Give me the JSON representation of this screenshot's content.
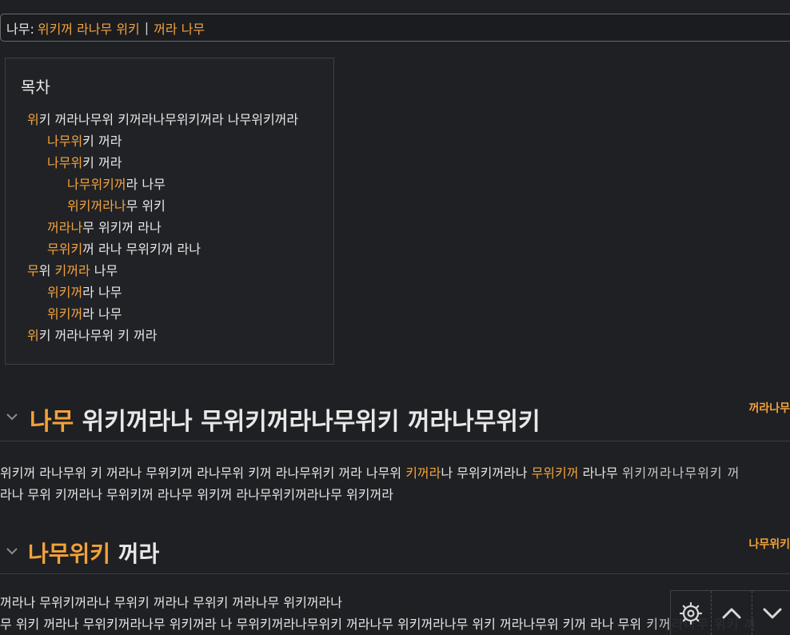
{
  "category_bar": {
    "label": "나무:",
    "links": [
      "위키꺼 라나무 위키",
      "꺼라 나무"
    ],
    "separator": "|"
  },
  "toc": {
    "title": "목차",
    "items": [
      {
        "level": 1,
        "num": "위",
        "text": "키 꺼라나무위 키꺼라나무위키꺼라 나무위키꺼라"
      },
      {
        "level": 2,
        "num": "나무위",
        "text": "키 꺼라"
      },
      {
        "level": 2,
        "num": "나무위",
        "text": "키 꺼라"
      },
      {
        "level": 3,
        "num": "나무위키꺼",
        "text": "라 나무"
      },
      {
        "level": 3,
        "num": "위키꺼라나",
        "text": "무 위키"
      },
      {
        "level": 2,
        "num": "꺼라나",
        "text": "무 위키꺼 라나"
      },
      {
        "level": 2,
        "num": "무위키",
        "text": "꺼 라나 무위키꺼 라나"
      },
      {
        "level": 1,
        "num": "무",
        "text": "위 ",
        "hl": "키꺼라",
        "tail": " 나무"
      },
      {
        "level": 2,
        "num": "위키꺼",
        "text": "라 나무"
      },
      {
        "level": 2,
        "num": "위키꺼",
        "text": "라 나무"
      },
      {
        "level": 1,
        "num": "위",
        "text": "키 꺼라나무위 키 꺼라"
      }
    ]
  },
  "sections": [
    {
      "num": "나무",
      "title": "위키꺼라나 무위키꺼라나무위키 꺼라나무위키",
      "edit": "꺼라나무"
    },
    {
      "num": "나무위키",
      "title": "꺼라",
      "edit": "나무위키"
    }
  ],
  "paragraph_1": {
    "line1_a": "위키꺼 라나무위 키 꺼라나 무위키꺼 라나무위 키꺼 라나무위키 꺼라 나무위 ",
    "line1_hl1": "키꺼라",
    "line1_b": "나 무위키꺼라나 ",
    "line1_hl2": "무위키꺼",
    "line1_c": " 라나무 ",
    "line1_d": "위키꺼라나무위키 꺼",
    "line2": "라나 무위 키꺼라나 무위키꺼 라나무 위키꺼 라나무위키꺼라나무 위키꺼라"
  },
  "paragraph_2": {
    "line1": "꺼라나 무위키꺼라나 무위키 꺼라나 무위키 꺼라나무 위키꺼라나",
    "line2_a": "무 위키 꺼라나 무위키꺼라나무 위키꺼라 나 무위키꺼라나무위키 꺼라나무 위키꺼라나무 위키 꺼라나무위 키꺼 라나 무위",
    "line2_b": " 키꺼라나무 위키 꺼"
  },
  "controls": {
    "settings_icon": "gear-icon",
    "up_icon": "chevron-up-icon",
    "down_icon": "chevron-down-icon"
  },
  "colors": {
    "accent": "#f2a23b",
    "background": "#1f2023",
    "text": "#e6e6e6"
  }
}
